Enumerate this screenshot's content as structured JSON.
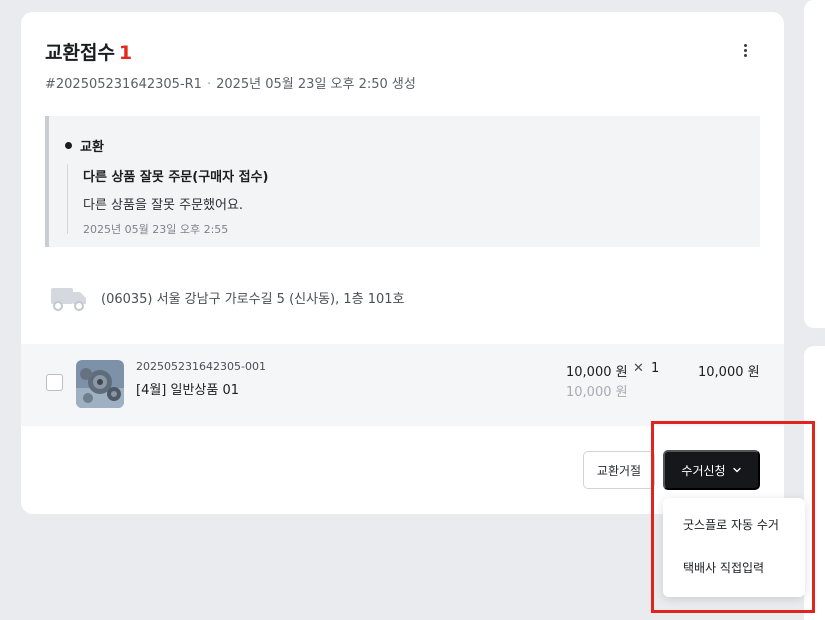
{
  "order": {
    "title": "교환접수",
    "count": "1",
    "id": "#202505231642305-R1",
    "created": "2025년 05월 23일 오후 2:50 생성"
  },
  "reason": {
    "type": "교환",
    "title": "다른 상품 잘못 주문(구매자 접수)",
    "description": "다른 상품을 잘못 주문했어요.",
    "time": "2025년 05월 23일 오후 2:55"
  },
  "address": "(06035) 서울 강남구 가로수길 5 (신사동), 1층 101호",
  "item": {
    "code": "202505231642305-001",
    "name": "[4월] 일반상품 01",
    "price": "10,000 원",
    "times": "✕",
    "qty": "1",
    "price_original": "10,000 원",
    "total": "10,000 원"
  },
  "actions": {
    "reject_label": "교환거절",
    "pickup_label": "수거신청",
    "options": [
      "굿스플로 자동 수거",
      "택배사 직접입력"
    ]
  },
  "colors": {
    "accent_red": "#e5281e",
    "dark_button": "#15171b",
    "highlight": "#e0241e"
  },
  "icons": [
    "kebab-menu-icon",
    "truck-icon",
    "chevron-down-icon"
  ]
}
